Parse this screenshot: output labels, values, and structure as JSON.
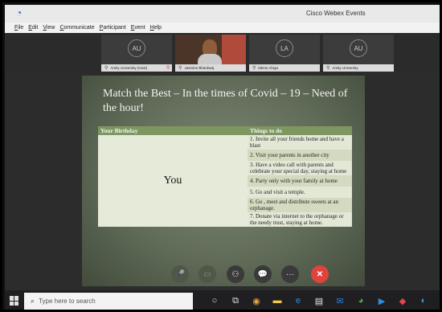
{
  "window": {
    "title": "Cisco Webex Events",
    "logo_glyph": "◔"
  },
  "menu": [
    "File",
    "Edit",
    "View",
    "Communicate",
    "Participant",
    "Event",
    "Help"
  ],
  "participants": [
    {
      "initials": "AU",
      "name": "Amity University (Host)",
      "has_video": false
    },
    {
      "initials": "",
      "name": "Jasmine Bhardwaj",
      "has_video": true
    },
    {
      "initials": "LA",
      "name": "lalmm Ahuja",
      "has_video": false
    },
    {
      "initials": "AU",
      "name": "Amity University",
      "has_video": false
    }
  ],
  "slide": {
    "title": "Match the Best – In the times of Covid – 19 – Need of the hour!",
    "table": {
      "headers": [
        "Your Birthday",
        "Things to do"
      ],
      "left_cell": "You",
      "items": [
        "1. Invite all your friends home and have a blast",
        "2. Visit your parents in another city",
        "3. Have a video call with parents and celebrate your special day, staying at home",
        "4. Party only with your family at home",
        "5. Go and visit a temple.",
        "6. Go , meet and distribute sweets at an orphanage.",
        "7. Donate via internet to the orphanage or the needy trust, staying at home."
      ]
    }
  },
  "controls": [
    {
      "name": "mute-icon",
      "glyph": "🎤",
      "style": "dim"
    },
    {
      "name": "video-icon",
      "glyph": "▭",
      "style": "dim"
    },
    {
      "name": "participants-icon",
      "glyph": "⚇",
      "style": "dark"
    },
    {
      "name": "chat-icon",
      "glyph": "💬",
      "style": "dark"
    },
    {
      "name": "more-icon",
      "glyph": "···",
      "style": "dark"
    },
    {
      "name": "leave-icon",
      "glyph": "✕",
      "style": "red"
    }
  ],
  "taskbar": {
    "search_placeholder": "Type here to search",
    "icons": [
      {
        "name": "cortana-icon",
        "glyph": "○",
        "color": "#e8e8e8"
      },
      {
        "name": "task-view-icon",
        "glyph": "⧉",
        "color": "#e8e8e8"
      },
      {
        "name": "paint-icon",
        "glyph": "◉",
        "color": "#e8a33a"
      },
      {
        "name": "file-explorer-icon",
        "glyph": "▬",
        "color": "#f2c94c"
      },
      {
        "name": "edge-icon",
        "glyph": "e",
        "color": "#2b8fe0"
      },
      {
        "name": "store-icon",
        "glyph": "▤",
        "color": "#e8e8e8"
      },
      {
        "name": "mail-icon",
        "glyph": "✉",
        "color": "#2f7fd8"
      },
      {
        "name": "chrome-icon",
        "glyph": "◕",
        "color": "#4caf50"
      },
      {
        "name": "media-icon",
        "glyph": "▶",
        "color": "#2b8fe0"
      },
      {
        "name": "photos-icon",
        "glyph": "◆",
        "color": "#e04848"
      },
      {
        "name": "network-icon",
        "glyph": "◐",
        "color": "#2aa3e0"
      }
    ]
  }
}
